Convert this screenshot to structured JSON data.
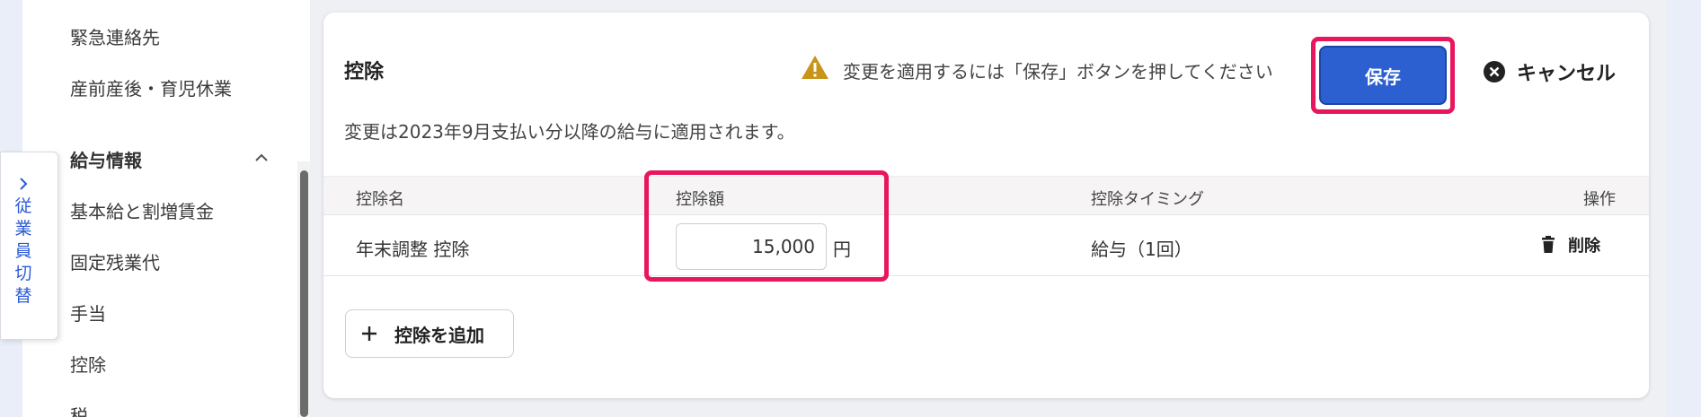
{
  "sidebar": {
    "items_top": [
      "緊急連絡先",
      "産前産後・育児休業"
    ],
    "section_heading": "給与情報",
    "section_items": [
      "基本給と割増賃金",
      "固定残業代",
      "手当",
      "控除",
      "税"
    ]
  },
  "switch_tab": {
    "label": "従業員切替"
  },
  "card": {
    "title": "控除",
    "warning": "変更を適用するには「保存」ボタンを押してください",
    "save_label": "保存",
    "cancel_label": "キャンセル",
    "notice": "変更は2023年9月支払い分以降の給与に適用されます。"
  },
  "table": {
    "headers": [
      "控除名",
      "控除額",
      "控除タイミング",
      "操作"
    ],
    "rows": [
      {
        "name": "年末調整 控除",
        "amount": "15,000",
        "unit": "円",
        "timing": "給与（1回）",
        "action": "削除"
      }
    ]
  },
  "add_button_label": "控除を追加",
  "colors": {
    "accent": "#2c5fd0",
    "highlight": "#e8175d",
    "warning": "#c8951a"
  }
}
